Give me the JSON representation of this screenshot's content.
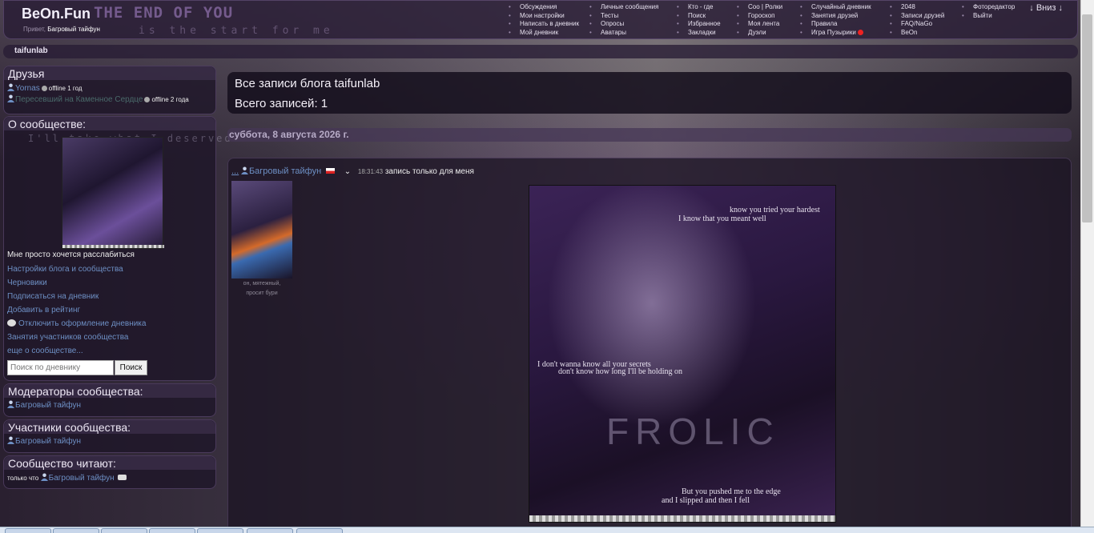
{
  "header": {
    "logo": "BeOn.Fun",
    "motto": "THE END OF YOU",
    "motto_sub": "is the start for me",
    "greeting_label": "Привет,",
    "greeting_user": "Багровый тайфун",
    "menu_col1": [
      "Обсуждения",
      "Мои настройки",
      "Написать в дневник",
      "Мой дневник"
    ],
    "menu_col2": [
      "Личные сообщения",
      "Тесты",
      "Опросы",
      "Аватары"
    ],
    "menu_col3": [
      "Кто - где",
      "Поиск",
      "Избранное",
      "Закладки"
    ],
    "menu_col4": [
      "Соо | Ролки",
      "Гороскоп",
      "Моя лента",
      "Дуэли"
    ],
    "menu_col5": [
      "Случайный дневник",
      "Занятия друзей",
      "Правила",
      "Игра Пузырики"
    ],
    "menu_col6": [
      "2048",
      "Записи друзей",
      "FAQ/NaGo",
      "BeOn"
    ],
    "menu_col7": [
      "Фотоpедактор",
      "Выйти"
    ],
    "scroll_down": "↓ Вниз ↓"
  },
  "breadcrumb": "taifunlab",
  "friends": {
    "title": "Друзья",
    "items": [
      {
        "name": "Yornas",
        "status": "offline 1 год"
      },
      {
        "name": "Пересевший на Каменное Сердце",
        "status": "offline 2 года"
      }
    ]
  },
  "about": {
    "title": "О сообществе:",
    "image_caption": "I'll take what I deserved",
    "tagline": "Мне просто хочется расслабиться",
    "links": [
      "Настройки блога и сообщества",
      "Черновики",
      "Подписаться на дневник",
      "Добавить в рейтинг",
      "Отключить оформление дневника",
      "Занятия участников сообщества",
      "еще о сообществе..."
    ],
    "search_placeholder": "Поиск по дневнику",
    "search_button": "Поиск"
  },
  "moderators": {
    "title": "Модераторы сообщества:",
    "user": "Багровый тайфун"
  },
  "members": {
    "title": "Участники сообщества:",
    "user": "Багровый тайфун"
  },
  "readers": {
    "title": "Сообщество читают:",
    "prefix": "только что",
    "user": "Багровый тайфун"
  },
  "main": {
    "title": "Все записи блога taifunlab",
    "count": "Всего записей: 1",
    "date": "суббота, 8 августа 2026 г.",
    "post": {
      "dots": "...",
      "author": "Багровый тайфун",
      "time": "18:31:43",
      "privacy": "запись только для меня",
      "avatar_caption_1": "он, мятежный,",
      "avatar_caption_2": "просит бури",
      "art_lines": [
        "know you tried your hardest",
        "I know that you meant well",
        "I don't wanna know all your secrets",
        "don't know how long I'll be holding on",
        "FROLIC",
        "But you pushed me to the edge",
        "and I slipped and then I fell"
      ]
    }
  }
}
